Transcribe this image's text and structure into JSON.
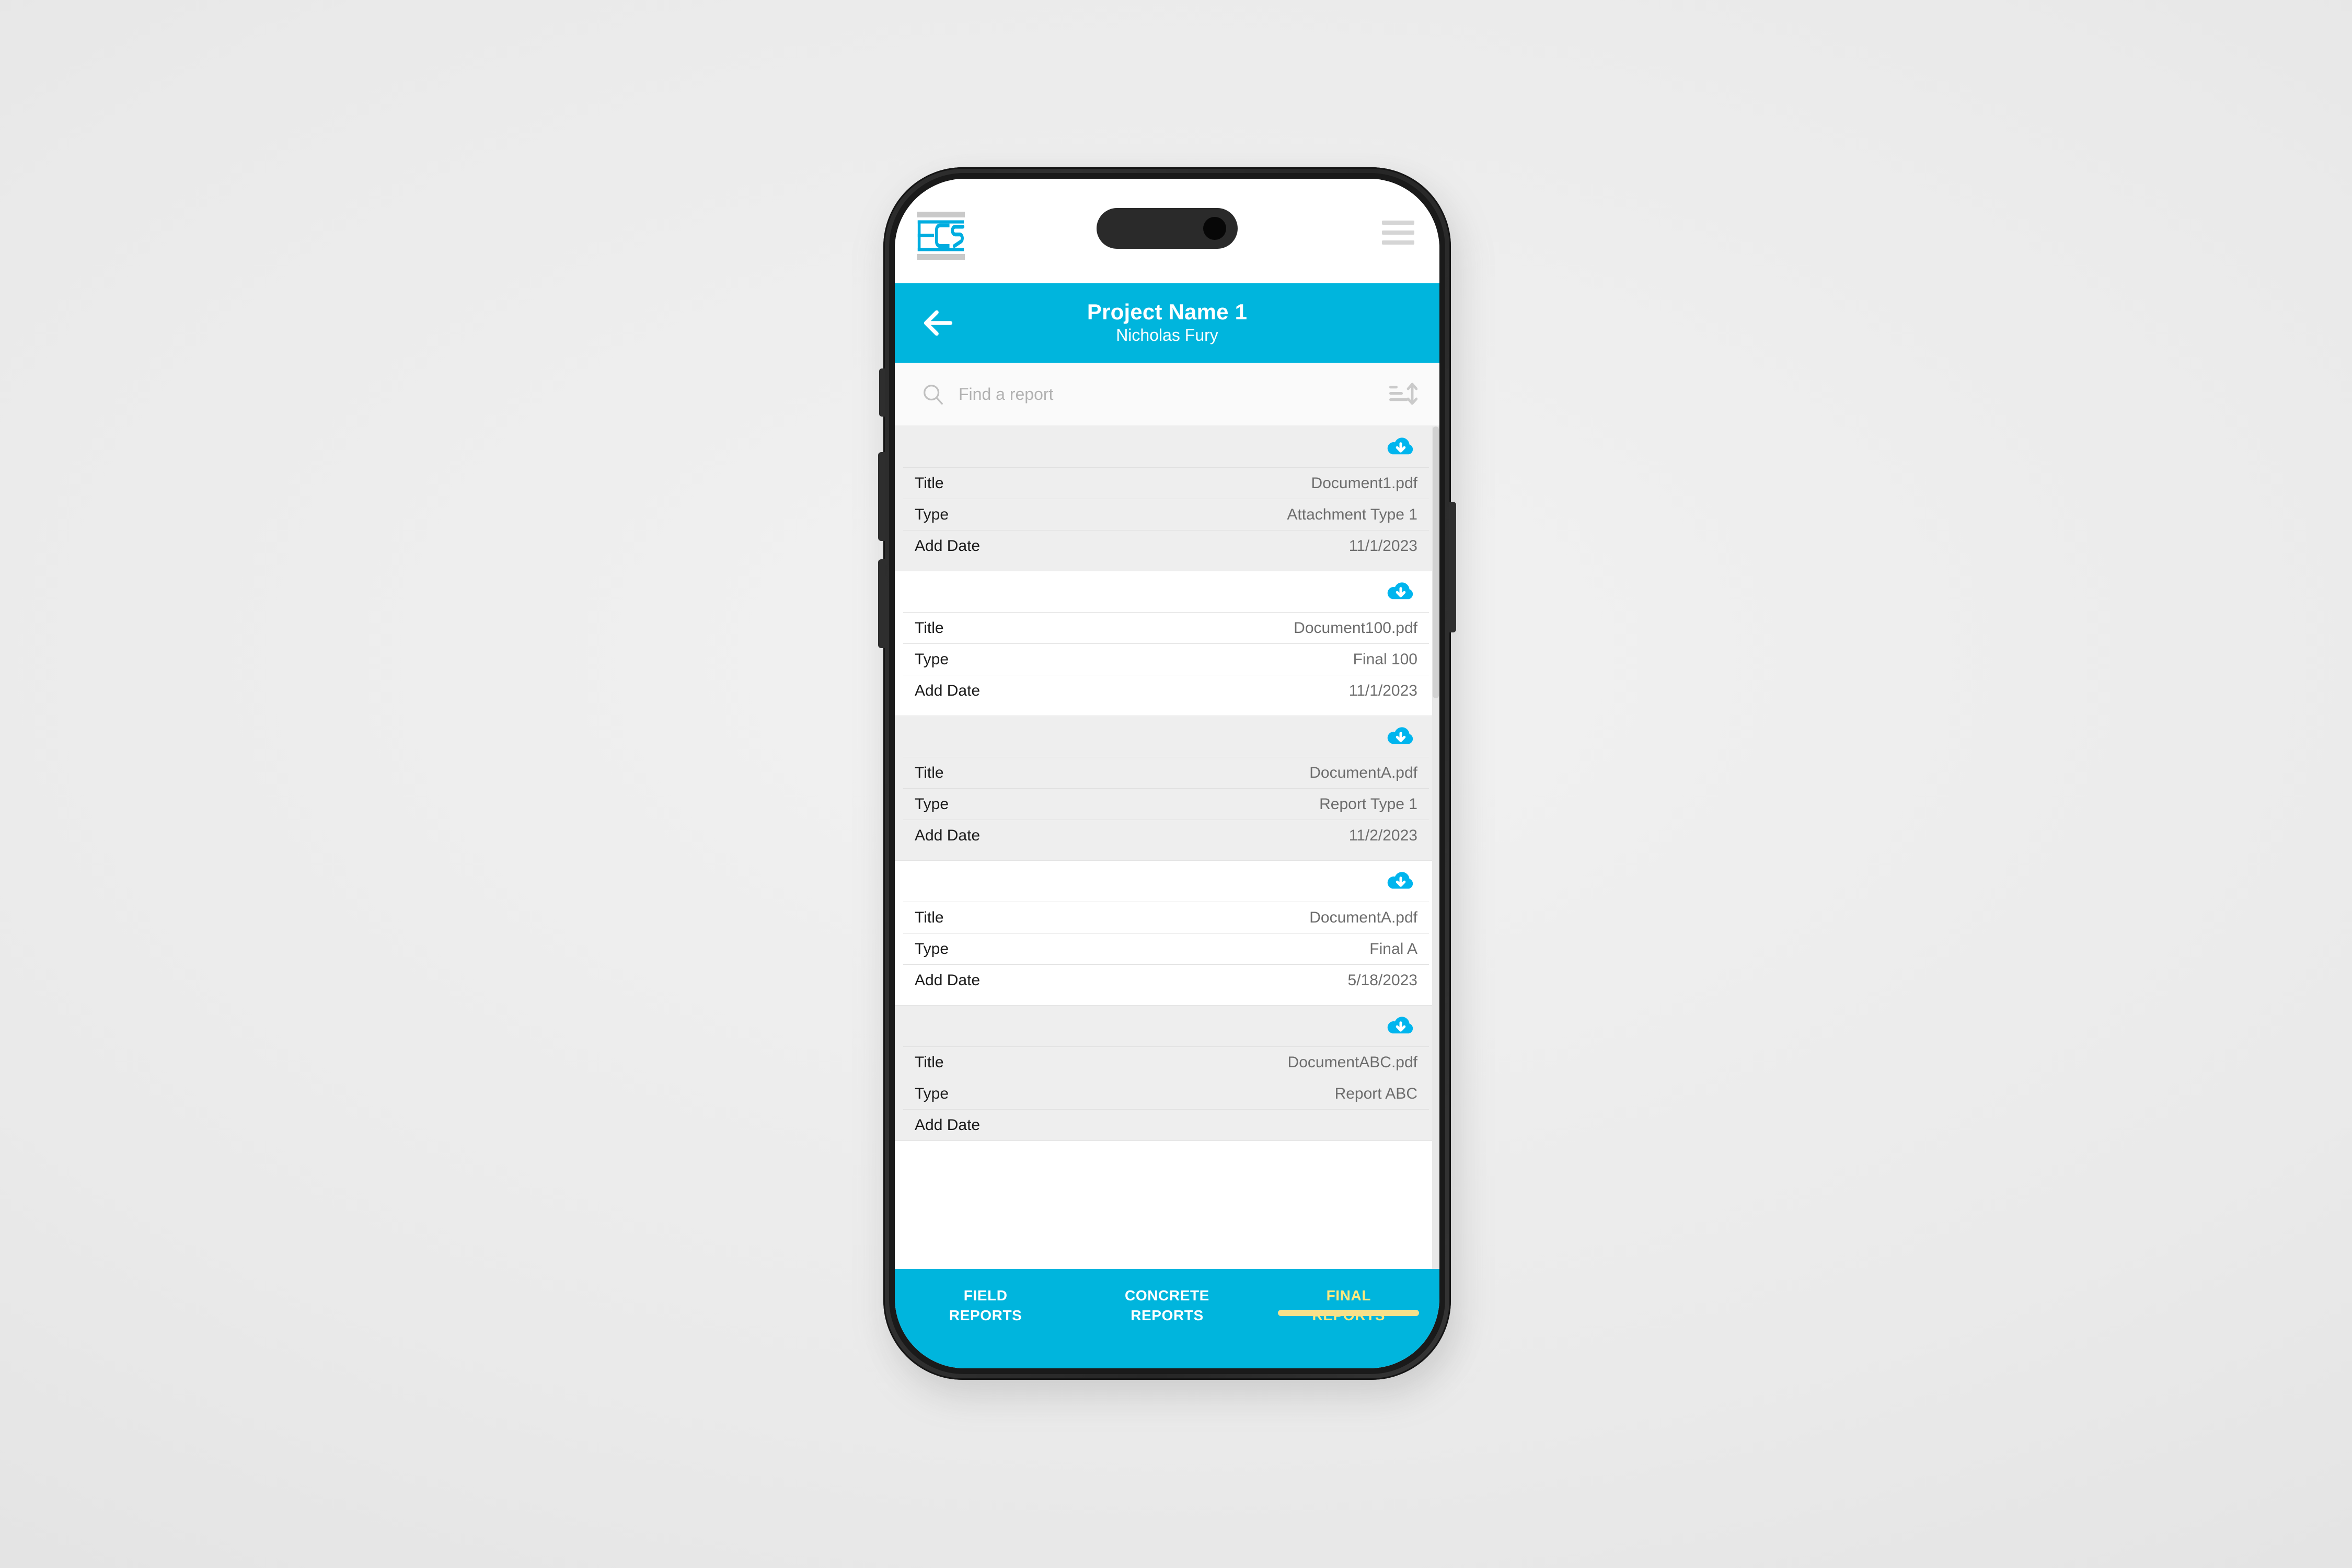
{
  "app": {
    "logo_alt": "ECS",
    "menu_icon": "hamburger-menu-icon"
  },
  "project_header": {
    "back_icon": "arrow-left-icon",
    "title": "Project Name 1",
    "subtitle": "Nicholas Fury"
  },
  "search": {
    "icon": "search-icon",
    "placeholder": "Find a report",
    "value": "",
    "sort_icon": "sort-ascending-icon"
  },
  "documents": {
    "row_labels": {
      "title": "Title",
      "type": "Type",
      "add_date": "Add Date"
    },
    "download_icon": "cloud-download-icon",
    "items": [
      {
        "title": "Document1.pdf",
        "type": "Attachment Type 1",
        "add_date": "11/1/2023"
      },
      {
        "title": "Document100.pdf",
        "type": "Final 100",
        "add_date": "11/1/2023"
      },
      {
        "title": "DocumentA.pdf",
        "type": "Report Type 1",
        "add_date": "11/2/2023"
      },
      {
        "title": "DocumentA.pdf",
        "type": "Final A",
        "add_date": "5/18/2023"
      },
      {
        "title": "DocumentABC.pdf",
        "type": "Report ABC",
        "add_date": ""
      }
    ]
  },
  "tabs": [
    {
      "line1": "FIELD",
      "line2": "REPORTS",
      "active": false
    },
    {
      "line1": "CONCRETE",
      "line2": "REPORTS",
      "active": false
    },
    {
      "line1": "FINAL",
      "line2": "REPORTS",
      "active": true
    }
  ],
  "colors": {
    "accent_cyan": "#00b5dd",
    "active_tab_yellow": "#ffe87c",
    "card_alt_gray": "#eeeeee",
    "label_dark": "#1b1b1b",
    "value_gray": "#6d6d6d"
  }
}
